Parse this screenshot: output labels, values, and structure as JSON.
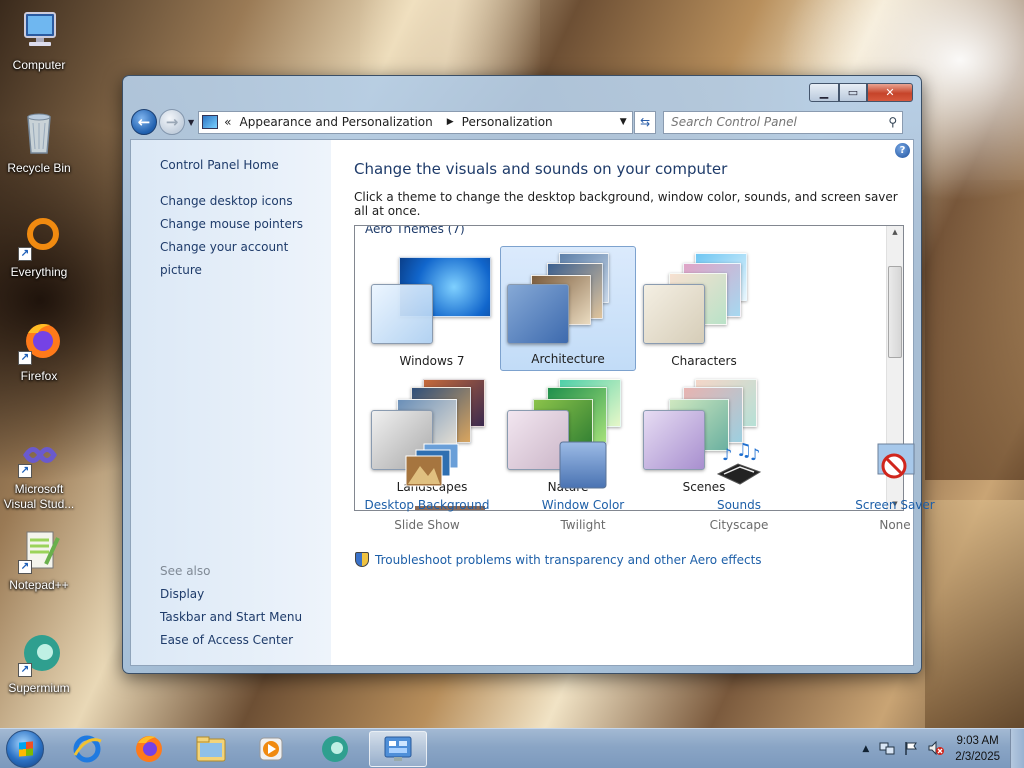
{
  "desktop": {
    "icons": [
      {
        "label": "Computer",
        "icon": "computer-icon"
      },
      {
        "label": "Recycle Bin",
        "icon": "recycle-bin-icon"
      },
      {
        "label": "Everything",
        "icon": "everything-icon"
      },
      {
        "label": "Firefox",
        "icon": "firefox-icon"
      },
      {
        "label": "Microsoft Visual Stud...",
        "icon": "visual-studio-icon"
      },
      {
        "label": "Notepad++",
        "icon": "notepadpp-icon"
      },
      {
        "label": "Supermium",
        "icon": "supermium-icon"
      }
    ]
  },
  "window": {
    "address": {
      "overflow": "«",
      "crumbs": [
        "Appearance and Personalization",
        "Personalization"
      ]
    },
    "search": {
      "placeholder": "Search Control Panel"
    },
    "left_pane": {
      "home": "Control Panel Home",
      "links": [
        "Change desktop icons",
        "Change mouse pointers",
        "Change your account picture"
      ],
      "see_also_header": "See also",
      "see_also": [
        "Display",
        "Taskbar and Start Menu",
        "Ease of Access Center"
      ]
    },
    "main": {
      "title": "Change the visuals and sounds on your computer",
      "subtitle": "Click a theme to change the desktop background, window color, sounds, and screen saver all at once.",
      "group_header": "Aero Themes (7)",
      "themes": [
        {
          "label": "Windows 7",
          "selected": false
        },
        {
          "label": "Architecture",
          "selected": true
        },
        {
          "label": "Characters",
          "selected": false
        },
        {
          "label": "Landscapes",
          "selected": false
        },
        {
          "label": "Nature",
          "selected": false
        },
        {
          "label": "Scenes",
          "selected": false
        }
      ],
      "bottom_items": [
        {
          "label": "Desktop Background",
          "value": "Slide Show",
          "icon": "desktop-background-icon"
        },
        {
          "label": "Window Color",
          "value": "Twilight",
          "icon": "window-color-icon"
        },
        {
          "label": "Sounds",
          "value": "Cityscape",
          "icon": "sounds-icon"
        },
        {
          "label": "Screen Saver",
          "value": "None",
          "icon": "screen-saver-icon"
        }
      ],
      "troubleshoot": "Troubleshoot problems with transparency and other Aero effects"
    }
  },
  "taskbar": {
    "pinned": [
      "internet-explorer-icon",
      "firefox-icon",
      "explorer-icon",
      "media-player-icon",
      "supermium-icon",
      "control-panel-icon"
    ],
    "active": "control-panel-icon",
    "clock": {
      "time": "9:03 AM",
      "date": "2/3/2025"
    }
  },
  "colors": {
    "link": "#1d5fa8",
    "heading": "#1e3b6a",
    "selection": "#c2dcf7"
  }
}
